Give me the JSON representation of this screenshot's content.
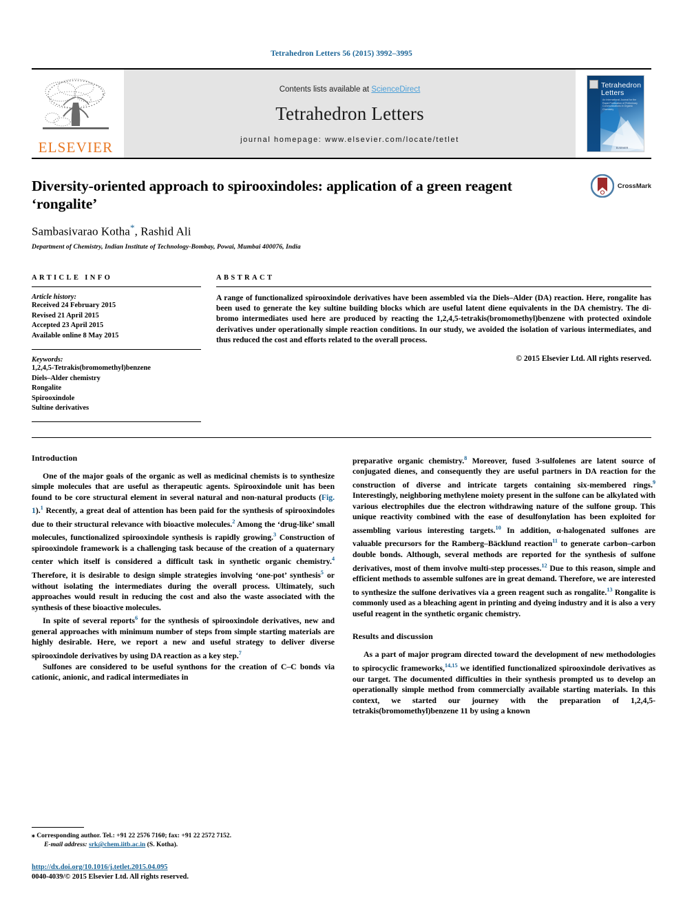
{
  "running_head": "Tetrahedron Letters 56 (2015) 3992–3995",
  "masthead": {
    "publisher_word": "ELSEVIER",
    "contents_prefix": "Contents lists available at ",
    "contents_link": "ScienceDirect",
    "journal_title": "Tetrahedron Letters",
    "homepage": "journal homepage: www.elsevier.com/locate/tetlet",
    "cover_title_line1": "Tetrahedron",
    "cover_title_line2": "Letters",
    "cover_subtitle": "An International Journal for the Rapid Publication of Preliminary Communications in Organic Chemistry",
    "cover_footer": "ELSEVIER"
  },
  "article": {
    "title": "Diversity-oriented approach to spirooxindoles: application of a green reagent ‘rongalite’",
    "authors_pre": "Sambasivarao Kotha",
    "corresponding_marker": "*",
    "authors_post": ", Rashid Ali",
    "affiliation": "Department of Chemistry, Indian Institute of Technology-Bombay, Powai, Mumbai 400076, India",
    "crossmark_label": "CrossMark"
  },
  "article_info": {
    "heading": "ARTICLE INFO",
    "history_label": "Article history:",
    "history": [
      "Received 24 February 2015",
      "Revised 21 April 2015",
      "Accepted 23 April 2015",
      "Available online 8 May 2015"
    ],
    "keywords_label": "Keywords:",
    "keywords": [
      "1,2,4,5-Tetrakis(bromomethyl)benzene",
      "Diels–Alder chemistry",
      "Rongalite",
      "Spirooxindole",
      "Sultine derivatives"
    ]
  },
  "abstract": {
    "heading": "ABSTRACT",
    "text": "A range of functionalized spirooxindole derivatives have been assembled via the Diels–Alder (DA) reaction. Here, rongalite has been used to generate the key sultine building blocks which are useful latent diene equivalents in the DA chemistry. The di-bromo intermediates used here are produced by reacting the 1,2,4,5-tetrakis(bromomethyl)benzene with protected oxindole derivatives under operationally simple reaction conditions. In our study, we avoided the isolation of various intermediates, and thus reduced the cost and efforts related to the overall process.",
    "copyright": "© 2015 Elsevier Ltd. All rights reserved."
  },
  "body": {
    "left": {
      "heading": "Introduction",
      "paragraphs": [
        "One of the major goals of the organic as well as medicinal chemists is to synthesize simple molecules that are useful as therapeutic agents. Spirooxindole unit has been found to be core structural element in several natural and non-natural products (Fig. 1).1 Recently, a great deal of attention has been paid for the synthesis of spirooxindoles due to their structural relevance with bioactive molecules.2 Among the ‘drug-like’ small molecules, functionalized spirooxindole synthesis is rapidly growing.3 Construction of spirooxindole framework is a challenging task because of the creation of a quaternary center which itself is considered a difficult task in synthetic organic chemistry.4 Therefore, it is desirable to design simple strategies involving ‘one-pot’ synthesis5 or without isolating the intermediates during the overall process. Ultimately, such approaches would result in reducing the cost and also the waste associated with the synthesis of these bioactive molecules.",
        "In spite of several reports6 for the synthesis of spirooxindole derivatives, new and general approaches with minimum number of steps from simple starting materials are highly desirable. Here, we report a new and useful strategy to deliver diverse spirooxindole derivatives by using DA reaction as a key step.7",
        "Sulfones are considered to be useful synthons for the creation of C–C bonds via cationic, anionic, and radical intermediates in"
      ]
    },
    "right": {
      "paragraphs_before_heading": [
        "preparative organic chemistry.8 Moreover, fused 3-sulfolenes are latent source of conjugated dienes, and consequently they are useful partners in DA reaction for the construction of diverse and intricate targets containing six-membered rings.9 Interestingly, neighboring methylene moiety present in the sulfone can be alkylated with various electrophiles due the electron withdrawing nature of the sulfone group. This unique reactivity combined with the ease of desulfonylation has been exploited for assembling various interesting targets.10 In addition, α-halogenated sulfones are valuable precursors for the Ramberg–Bäcklund reaction11 to generate carbon–carbon double bonds. Although, several methods are reported for the synthesis of sulfone derivatives, most of them involve multi-step processes.12 Due to this reason, simple and efficient methods to assemble sulfones are in great demand. Therefore, we are interested to synthesize the sulfone derivatives via a green reagent such as rongalite.13 Rongalite is commonly used as a bleaching agent in printing and dyeing industry and it is also a very useful reagent in the synthetic organic chemistry."
      ],
      "heading": "Results and discussion",
      "paragraphs_after_heading": [
        "As a part of major program directed toward the development of new methodologies to spirocyclic frameworks,14,15 we identified functionalized spirooxindole derivatives as our target. The documented difficulties in their synthesis prompted us to develop an operationally simple method from commercially available starting materials. In this context, we started our journey with the preparation of 1,2,4,5-tetrakis(bromomethyl)benzene 11 by using a known"
      ]
    }
  },
  "footnote": {
    "corresponding": "Corresponding author. Tel.: +91 22 2576 7160; fax: +91 22 2572 7152.",
    "email_label": "E-mail address:",
    "email": "srk@chem.iitb.ac.in",
    "email_suffix": " (S. Kotha).",
    "doi": "http://dx.doi.org/10.1016/j.tetlet.2015.04.095",
    "issn": "0040-4039/© 2015 Elsevier Ltd. All rights reserved."
  },
  "colors": {
    "link_blue": "#1a6496",
    "sciencedirect_blue": "#4a9fd8",
    "elsevier_orange": "#E87722",
    "crossmark_red": "#9E2A2B",
    "crossmark_blue": "#4d7ea8"
  }
}
